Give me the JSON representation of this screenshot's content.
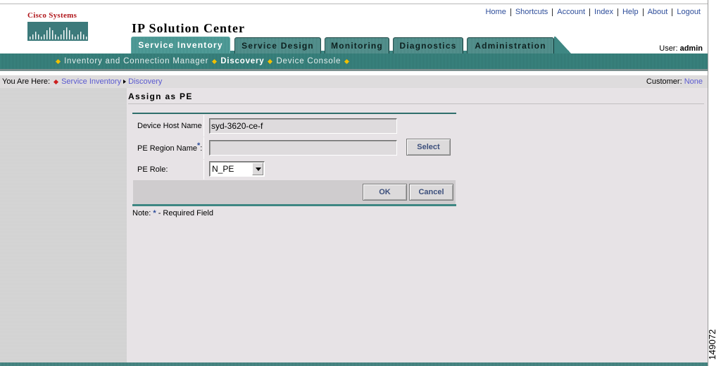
{
  "brand": {
    "logo_text": "Cisco Systems"
  },
  "app_title": "IP Solution Center",
  "top_links": [
    "Home",
    "Shortcuts",
    "Account",
    "Index",
    "Help",
    "About",
    "Logout"
  ],
  "user": {
    "label": "User:",
    "name": "admin"
  },
  "tabs": [
    {
      "label": "Service Inventory",
      "active": true
    },
    {
      "label": "Service Design",
      "active": false
    },
    {
      "label": "Monitoring",
      "active": false
    },
    {
      "label": "Diagnostics",
      "active": false
    },
    {
      "label": "Administration",
      "active": false
    }
  ],
  "subnav": [
    {
      "label": "Inventory and Connection Manager",
      "current": false
    },
    {
      "label": "Discovery",
      "current": true
    },
    {
      "label": "Device Console",
      "current": false
    }
  ],
  "breadcrumb": {
    "prefix": "You Are Here:",
    "items": [
      "Service Inventory",
      "Discovery"
    ]
  },
  "customer": {
    "label": "Customer:",
    "value": "None"
  },
  "page_title": "Assign as PE",
  "form": {
    "device_host_name": {
      "label": "Device Host Name",
      "value": "syd-3620-ce-f"
    },
    "pe_region_name": {
      "label": "PE Region Name",
      "required_mark": "*",
      "suffix": ":",
      "value": "",
      "select_label": "Select"
    },
    "pe_role": {
      "label": "PE Role:",
      "value": "N_PE"
    },
    "ok_label": "OK",
    "cancel_label": "Cancel"
  },
  "note": {
    "prefix": "Note:",
    "star": "*",
    "text": "- Required Field"
  },
  "figure_id": "149072",
  "colors": {
    "teal": "#3e8783",
    "link": "#2d4d9a",
    "logo_red": "#b0151a"
  }
}
